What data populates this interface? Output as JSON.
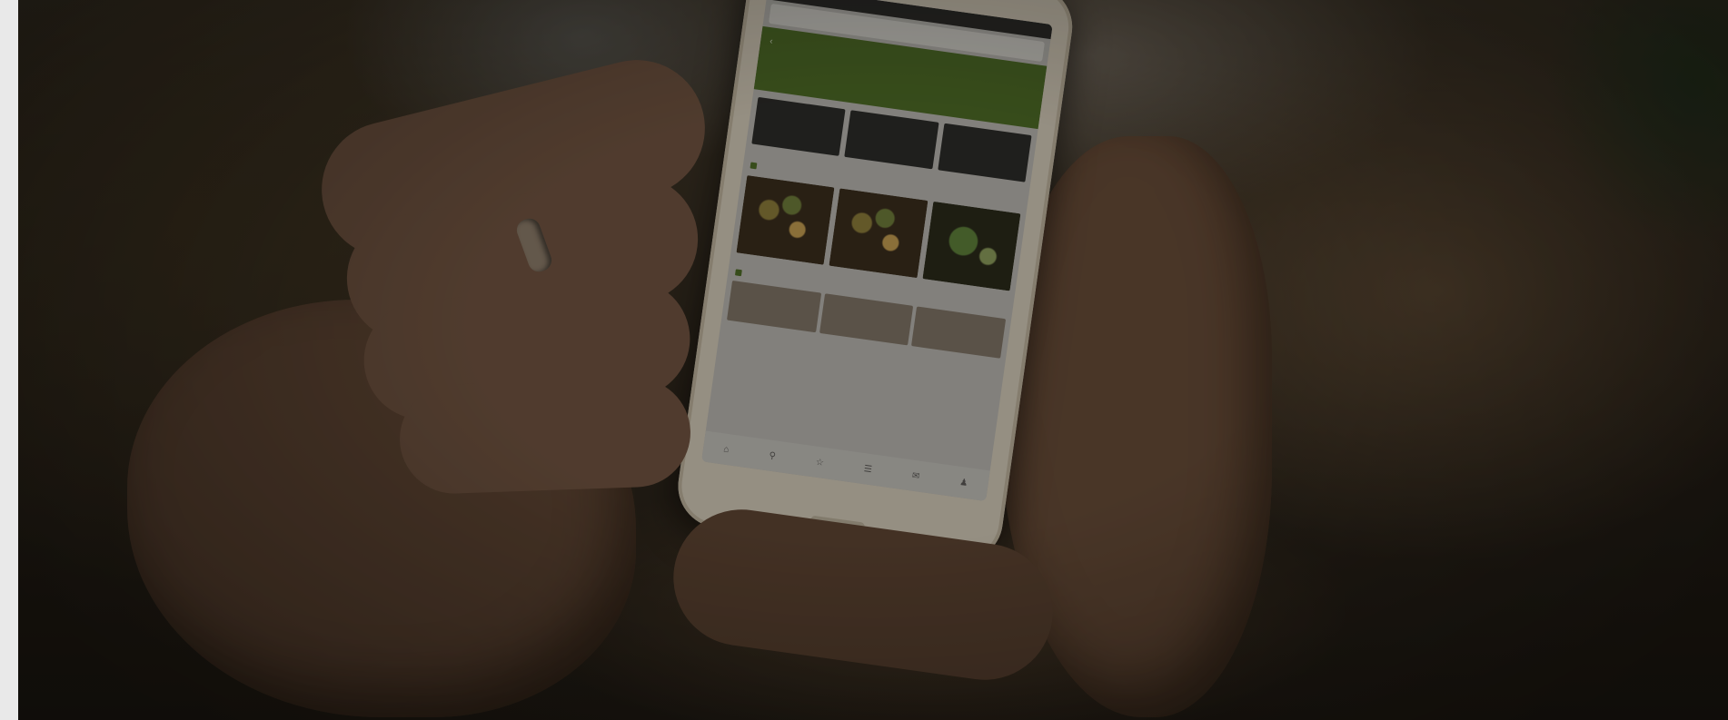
{
  "scene": {
    "subject": "hands-holding-smartphone",
    "background_left_strip": "#e9e9e9",
    "overlay_color": "#000000",
    "app_accent": "#4d6a26"
  },
  "phone_screen": {
    "status_text": "",
    "search_placeholder": "",
    "search_action": "",
    "banner_text": "",
    "tiles": [
      {
        "label": ""
      },
      {
        "label": ""
      },
      {
        "label": ""
      }
    ],
    "section_title": "",
    "section_link": "",
    "subsection_title": "",
    "second_subsection_title": ""
  }
}
